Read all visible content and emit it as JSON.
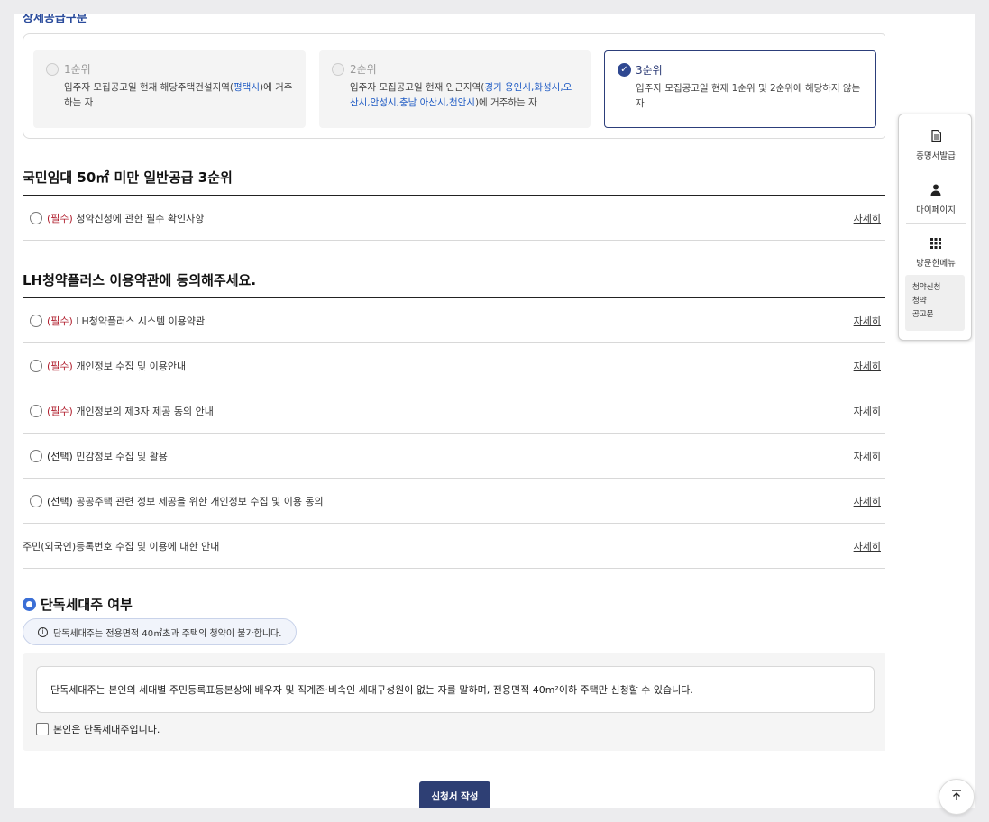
{
  "section_cut_title": "상세공급구분",
  "rank": {
    "cards": [
      {
        "title": "1순위",
        "desc_parts": [
          "입주자 모집공고일 현재 해당주택건설지역(",
          "평택시",
          ")에 거주하는 자"
        ]
      },
      {
        "title": "2순위",
        "desc_parts": [
          "입주자 모집공고일 현재 인근지역(",
          "경기 용인시,화성시,오산시,안성시,충남 아산시,천안시",
          ")에 거주하는 자"
        ]
      },
      {
        "title": "3순위",
        "desc": "입주자 모집공고일 현재 1순위 및 2순위에 해당하지 않는 자"
      }
    ]
  },
  "notice_section": {
    "title": "국민임대 50㎡ 미만 일반공급 3순위",
    "items": [
      {
        "tag": "(필수)",
        "label": "청약신청에 관한 필수 확인사항",
        "detail": "자세히"
      }
    ]
  },
  "terms_section": {
    "title": "LH청약플러스 이용약관에 동의해주세요.",
    "items": [
      {
        "tag": "(필수)",
        "label": "LH청약플러스 시스템 이용약관",
        "detail": "자세히"
      },
      {
        "tag": "(필수)",
        "label": "개인정보 수집 및 이용안내",
        "detail": "자세히"
      },
      {
        "tag": "(필수)",
        "label": "개인정보의 제3자 제공 동의 안내",
        "detail": "자세히"
      },
      {
        "tag": "(선택)",
        "label": "민감정보 수집 및 활용",
        "detail": "자세히"
      },
      {
        "tag": "(선택)",
        "label": "공공주택 관련 정보 제공을 위한 개인정보 수집 및 이용 동의",
        "detail": "자세히"
      }
    ],
    "resident_item": {
      "label": "주민(외국인)등록번호 수집 및 이용에 대한 안내",
      "detail": "자세히"
    }
  },
  "single_household": {
    "title": "단독세대주 여부",
    "info": "단독세대주는 전용면적 40㎡초과 주택의 청약이 불가합니다.",
    "desc": "단독세대주는 본인의 세대별 주민등록표등본상에 배우자 및 직계존·비속인 세대구성원이 없는 자를 말하며, 전용면적 40m²이하 주택만 신청할 수 있습니다.",
    "check_label": "본인은 단독세대주입니다."
  },
  "submit_label": "신청서 작성",
  "quick_menu": {
    "items": [
      {
        "icon": "document-icon",
        "label": "증명서발급"
      },
      {
        "icon": "person-icon",
        "label": "마이페이지"
      },
      {
        "icon": "grid-icon",
        "label": "방문한메뉴"
      }
    ],
    "visited": [
      "청약신청",
      "청약",
      "공고문"
    ]
  },
  "colors": {
    "accent": "#2e3f74",
    "required": "#b01f2e",
    "link": "#1f5bc4"
  }
}
